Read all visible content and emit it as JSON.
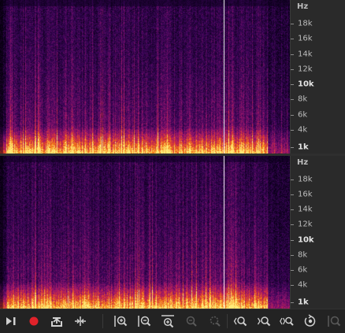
{
  "channels": [
    {
      "name": "top",
      "unit": "Hz",
      "ticks": [
        "18k",
        "16k",
        "14k",
        "12k",
        "10k",
        "8k",
        "6k",
        "4k",
        "1k"
      ],
      "bold_ticks": [
        "10k",
        "1k"
      ]
    },
    {
      "name": "bottom",
      "unit": "Hz",
      "ticks": [
        "18k",
        "16k",
        "14k",
        "12k",
        "10k",
        "8k",
        "6k",
        "4k",
        "1k"
      ],
      "bold_ticks": [
        "10k",
        "1k"
      ]
    }
  ],
  "toolbar": {
    "buttons": [
      "play-to-end-icon",
      "record-icon",
      "export-icon",
      "split-icon",
      "zoom-in-vertical-icon",
      "zoom-out-vertical-icon",
      "zoom-fit-horizontal-icon",
      "zoom-out-disabled-icon",
      "zoom-selection-disabled-icon",
      "zoom-left-icon",
      "zoom-right-icon",
      "zoom-both-icon",
      "zoom-reset-icon",
      "zoom-full-disabled-icon"
    ]
  },
  "colors": {
    "accent_record": "#e0222a",
    "spec_low": "#1a0030",
    "spec_mid": "#b0186a",
    "spec_high": "#ffb020",
    "playhead": "#ffffff"
  }
}
